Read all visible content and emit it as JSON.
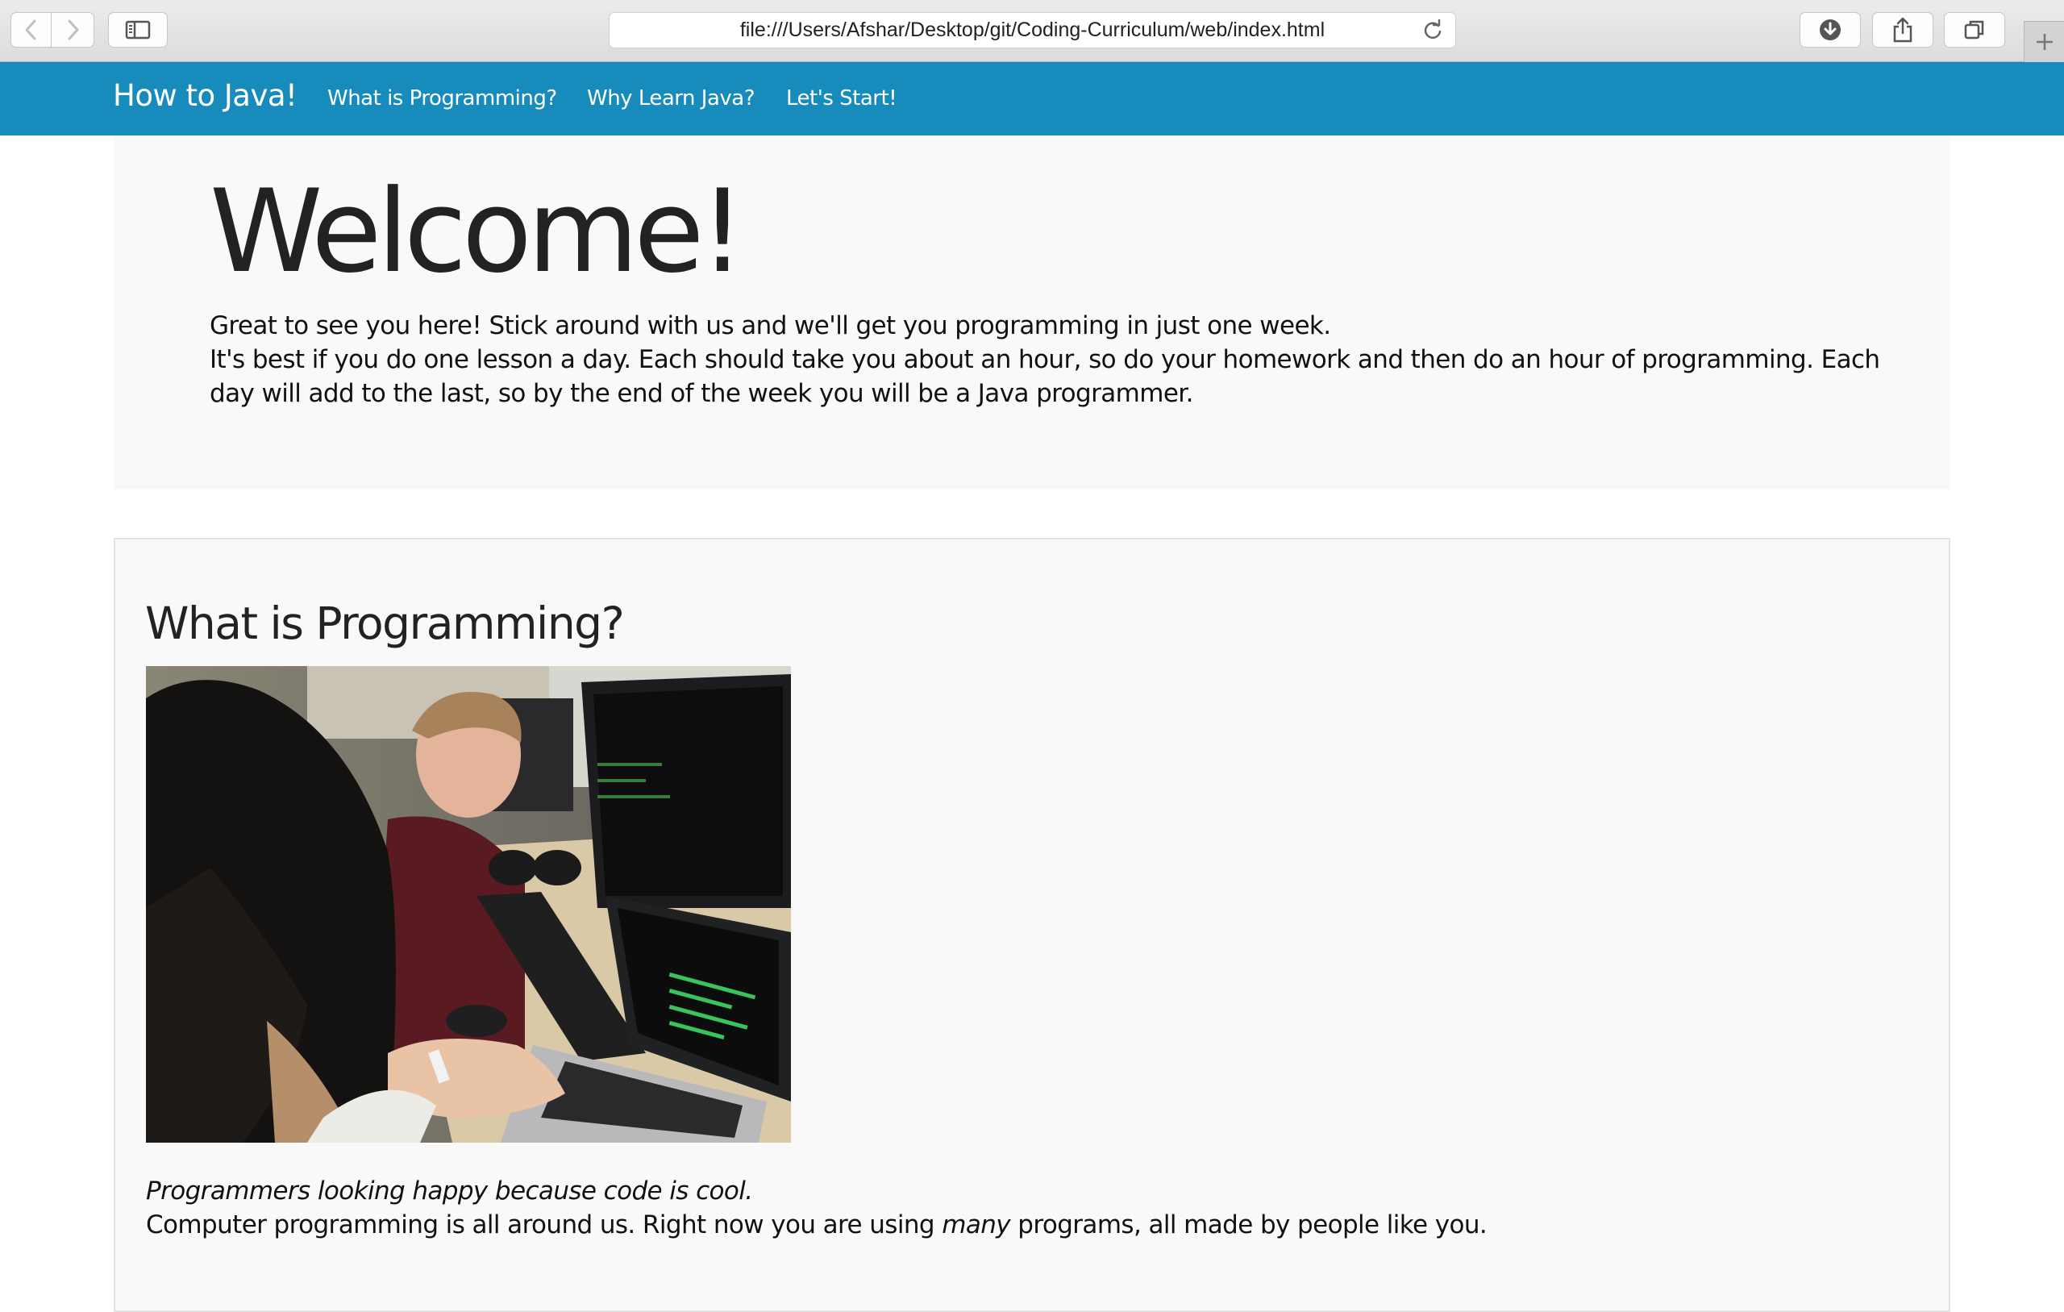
{
  "browser": {
    "url": "file:///Users/Afshar/Desktop/git/Coding-Curriculum/web/index.html",
    "toolbar_icons": [
      "back-arrow-icon",
      "forward-arrow-icon",
      "sidebar-icon",
      "reload-icon",
      "download-icon",
      "share-icon",
      "tabs-overview-icon",
      "plus-icon"
    ]
  },
  "navbar": {
    "brand": "How to Java!",
    "links": [
      {
        "label": "What is Programming?"
      },
      {
        "label": "Why Learn Java?"
      },
      {
        "label": "Let's Start!"
      }
    ],
    "color": "#178bbc"
  },
  "jumbotron": {
    "heading": "Welcome!",
    "paragraphs": [
      "Great to see you here! Stick around with us and we'll get you programming in just one week.",
      "It's best if you do one lesson a day. Each should take you about an hour, so do your homework and then do an hour of programming. Each day will add to the last, so by the end of the week you will be a Java programmer."
    ]
  },
  "section": {
    "heading": "What is Programming?",
    "caption": "Programmers looking happy because code is cool.",
    "body_before": "Computer programming is all around us. Right now you are using ",
    "body_emphasis": "many",
    "body_after": " programs, all made by people like you."
  }
}
